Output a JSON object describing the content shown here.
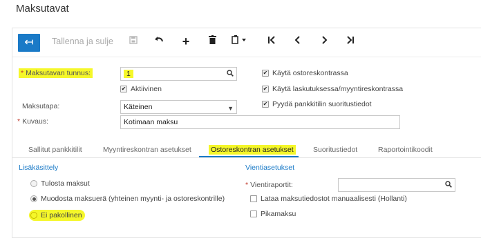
{
  "page": {
    "title": "Maksutavat"
  },
  "toolbar": {
    "back_icon": "arrow-left-icon",
    "save_close_label": "Tallenna ja sulje",
    "icons": [
      "save-icon",
      "undo-icon",
      "add-icon",
      "delete-icon",
      "copy-icon",
      "first-icon",
      "previous-icon",
      "next-icon",
      "last-icon"
    ]
  },
  "form": {
    "code_label": "Maksutavan tunnus:",
    "code_value": "1",
    "active_label": "Aktiivinen",
    "method_label": "Maksutapa:",
    "method_value": "Käteinen",
    "description_label": "Kuvaus:",
    "description_value": "Kotimaan maksu",
    "checks": [
      {
        "label": "Käytä ostoreskontrassa",
        "checked": true
      },
      {
        "label": "Käytä laskutuksessa/myyntireskontrassa",
        "checked": true
      },
      {
        "label": "Pyydä pankkitilin suoritustiedot",
        "checked": true
      }
    ]
  },
  "tabs": [
    {
      "label": "Sallitut pankkitilit",
      "active": false
    },
    {
      "label": "Myyntireskontran asetukset",
      "active": false
    },
    {
      "label": "Ostoreskontran asetukset",
      "active": true
    },
    {
      "label": "Suoritustiedot",
      "active": false
    },
    {
      "label": "Raportointikoodit",
      "active": false
    }
  ],
  "left_section": {
    "title": "Lisäkäsittely",
    "options": [
      {
        "label": "Tulosta maksut",
        "selected": false
      },
      {
        "label": "Muodosta maksuerä (yhteinen myynti- ja ostoreskontrille)",
        "selected": true
      },
      {
        "label": "Ei pakollinen",
        "selected": false
      }
    ]
  },
  "right_section": {
    "title": "Vientiasetukset",
    "report_label": "Vientiraportit:",
    "report_value": "",
    "checks": [
      {
        "label": "Lataa maksutiedostot manuaalisesti (Hollanti)",
        "checked": false
      },
      {
        "label": "Pikamaksu",
        "checked": false
      }
    ]
  },
  "colors": {
    "accent": "#1a7ac7",
    "highlight": "#f5f72a",
    "required": "#c0392b"
  }
}
